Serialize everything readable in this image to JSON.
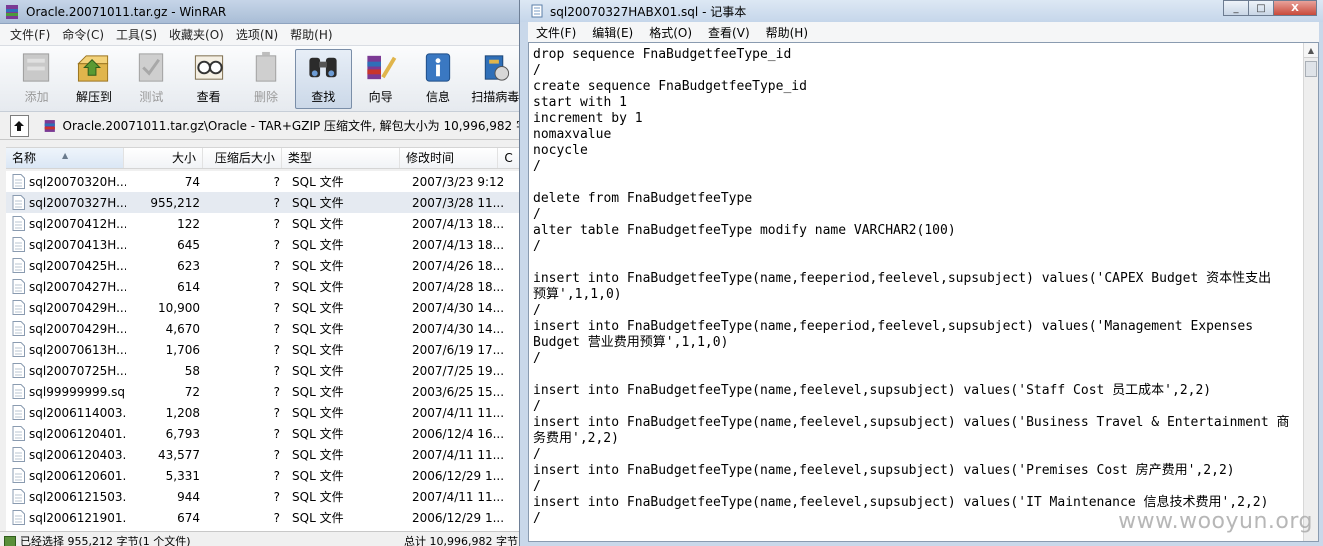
{
  "winrar": {
    "title": "Oracle.20071011.tar.gz - WinRAR",
    "menu": [
      "文件(F)",
      "命令(C)",
      "工具(S)",
      "收藏夹(O)",
      "选项(N)",
      "帮助(H)"
    ],
    "toolbar": [
      {
        "label": "添加",
        "icon": "add-icon",
        "disabled": true
      },
      {
        "label": "解压到",
        "icon": "extract-icon",
        "disabled": false
      },
      {
        "label": "测试",
        "icon": "test-icon",
        "disabled": true
      },
      {
        "label": "查看",
        "icon": "view-icon",
        "disabled": false
      },
      {
        "label": "删除",
        "icon": "delete-icon",
        "disabled": true
      },
      {
        "label": "查找",
        "icon": "find-icon",
        "disabled": false,
        "active": true
      },
      {
        "label": "向导",
        "icon": "wizard-icon",
        "disabled": false
      },
      {
        "label": "信息",
        "icon": "info-icon",
        "disabled": false
      },
      {
        "label": "扫描病毒",
        "icon": "virus-scan-icon",
        "disabled": false
      }
    ],
    "path": "Oracle.20071011.tar.gz\\Oracle - TAR+GZIP 压缩文件, 解包大小为 10,996,982 字",
    "columns": {
      "name": "名称",
      "size": "大小",
      "packed": "压缩后大小",
      "type": "类型",
      "modified": "修改时间",
      "crc": "C"
    },
    "files": [
      {
        "name": "sql20070320H...",
        "size": "74",
        "packed": "?",
        "type": "SQL 文件",
        "modified": "2007/3/23 9:12"
      },
      {
        "name": "sql20070327H...",
        "size": "955,212",
        "packed": "?",
        "type": "SQL 文件",
        "modified": "2007/3/28 11...",
        "selected": true
      },
      {
        "name": "sql20070412H...",
        "size": "122",
        "packed": "?",
        "type": "SQL 文件",
        "modified": "2007/4/13 18..."
      },
      {
        "name": "sql20070413H...",
        "size": "645",
        "packed": "?",
        "type": "SQL 文件",
        "modified": "2007/4/13 18..."
      },
      {
        "name": "sql20070425H...",
        "size": "623",
        "packed": "?",
        "type": "SQL 文件",
        "modified": "2007/4/26 18..."
      },
      {
        "name": "sql20070427H...",
        "size": "614",
        "packed": "?",
        "type": "SQL 文件",
        "modified": "2007/4/28 18..."
      },
      {
        "name": "sql20070429H...",
        "size": "10,900",
        "packed": "?",
        "type": "SQL 文件",
        "modified": "2007/4/30 14..."
      },
      {
        "name": "sql20070429H...",
        "size": "4,670",
        "packed": "?",
        "type": "SQL 文件",
        "modified": "2007/4/30 14..."
      },
      {
        "name": "sql20070613H...",
        "size": "1,706",
        "packed": "?",
        "type": "SQL 文件",
        "modified": "2007/6/19 17..."
      },
      {
        "name": "sql20070725H...",
        "size": "58",
        "packed": "?",
        "type": "SQL 文件",
        "modified": "2007/7/25 19..."
      },
      {
        "name": "sql99999999.sql",
        "size": "72",
        "packed": "?",
        "type": "SQL 文件",
        "modified": "2003/6/25 15..."
      },
      {
        "name": "sql2006114003...",
        "size": "1,208",
        "packed": "?",
        "type": "SQL 文件",
        "modified": "2007/4/11 11..."
      },
      {
        "name": "sql2006120401...",
        "size": "6,793",
        "packed": "?",
        "type": "SQL 文件",
        "modified": "2006/12/4 16..."
      },
      {
        "name": "sql2006120403...",
        "size": "43,577",
        "packed": "?",
        "type": "SQL 文件",
        "modified": "2007/4/11 11..."
      },
      {
        "name": "sql2006120601...",
        "size": "5,331",
        "packed": "?",
        "type": "SQL 文件",
        "modified": "2006/12/29 1..."
      },
      {
        "name": "sql2006121503...",
        "size": "944",
        "packed": "?",
        "type": "SQL 文件",
        "modified": "2007/4/11 11..."
      },
      {
        "name": "sql2006121901...",
        "size": "674",
        "packed": "?",
        "type": "SQL 文件",
        "modified": "2006/12/29 1..."
      }
    ],
    "status": {
      "selected": "已经选择 955,212 字节(1 个文件)",
      "total": "总计 10,996,982 字节"
    }
  },
  "notepad": {
    "title": "sql20070327HABX01.sql - 记事本",
    "menu": [
      "文件(F)",
      "编辑(E)",
      "格式(O)",
      "查看(V)",
      "帮助(H)"
    ],
    "window_buttons": {
      "minimize": "_",
      "maximize": "□",
      "close": "X"
    },
    "lines": [
      "drop sequence FnaBudgetfeeType_id",
      "/",
      "create sequence FnaBudgetfeeType_id",
      "start with 1",
      "increment by 1",
      "nomaxvalue",
      "nocycle",
      "/",
      "",
      "delete from FnaBudgetfeeType",
      "/",
      "alter table FnaBudgetfeeType modify name VARCHAR2(100)",
      "/",
      "",
      "insert into FnaBudgetfeeType(name,feeperiod,feelevel,supsubject) values('CAPEX Budget 资本性支出",
      "预算',1,1,0)",
      "/",
      "insert into FnaBudgetfeeType(name,feeperiod,feelevel,supsubject) values('Management Expenses",
      "Budget 营业费用预算',1,1,0)",
      "/",
      "",
      "insert into FnaBudgetfeeType(name,feelevel,supsubject) values('Staff Cost 员工成本',2,2)",
      "/",
      "insert into FnaBudgetfeeType(name,feelevel,supsubject) values('Business Travel & Entertainment 商",
      "务费用',2,2)",
      "/",
      "insert into FnaBudgetfeeType(name,feelevel,supsubject) values('Premises Cost 房产费用',2,2)",
      "/",
      "insert into FnaBudgetfeeType(name,feelevel,supsubject) values('IT Maintenance 信息技术费用',2,2)",
      "/"
    ]
  },
  "watermark": "www.wooyun.org"
}
